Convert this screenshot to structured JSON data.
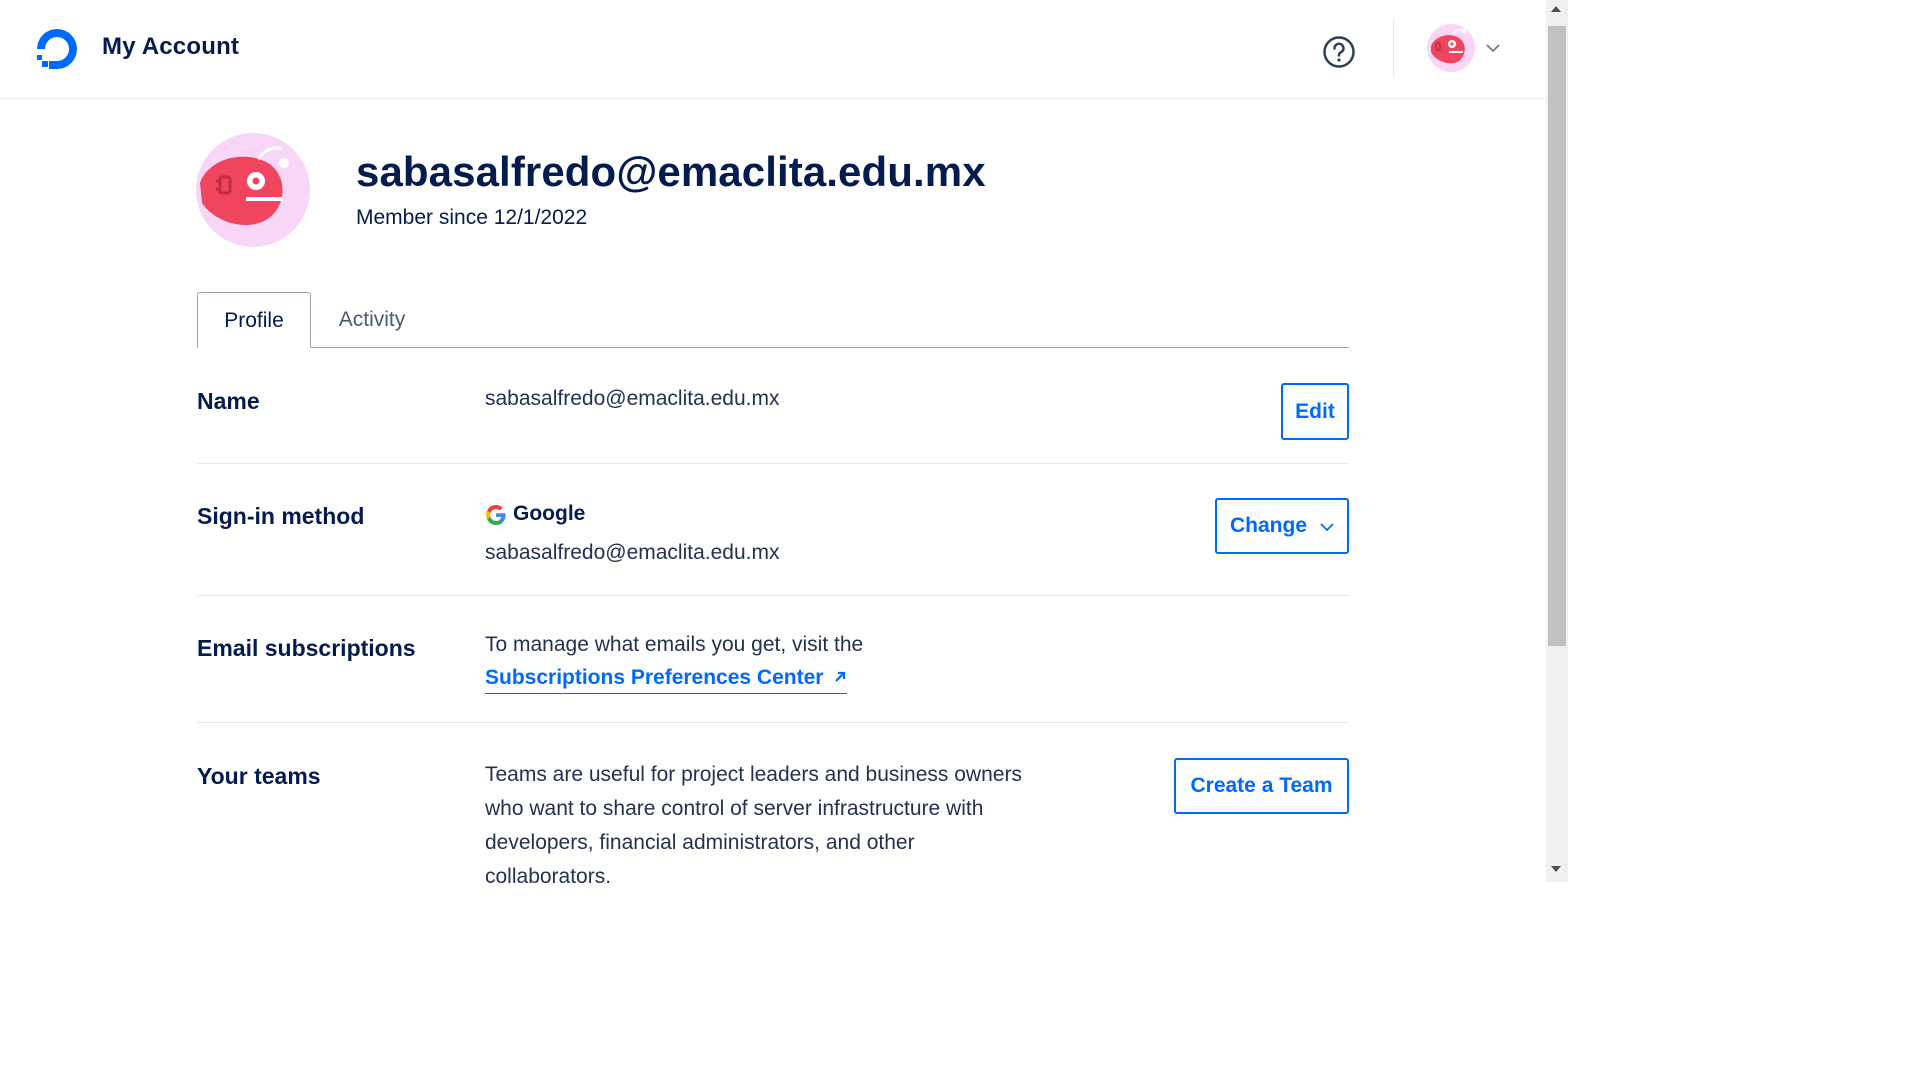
{
  "header": {
    "logo_icon": "digitalocean-logo-icon",
    "title": "My Account",
    "help_icon": "help-circle-icon",
    "avatar_icon": "anglerfish-avatar-icon",
    "menu_icon": "chevron-down-icon"
  },
  "profile": {
    "email": "sabasalfredo@emaclita.edu.mx",
    "member_since": "Member since 12/1/2022"
  },
  "tabs": [
    {
      "label": "Profile",
      "active": true
    },
    {
      "label": "Activity",
      "active": false
    }
  ],
  "rows": {
    "name": {
      "label": "Name",
      "value": "sabasalfredo@emaclita.edu.mx",
      "button": "Edit"
    },
    "signin": {
      "label": "Sign-in method",
      "provider": "Google",
      "provider_icon": "google-icon",
      "email": "sabasalfredo@emaclita.edu.mx",
      "button": "Change"
    },
    "email_subscriptions": {
      "label": "Email subscriptions",
      "text": "To manage what emails you get, visit the",
      "link": "Subscriptions Preferences Center",
      "link_icon": "external-arrow-icon"
    },
    "teams": {
      "label": "Your teams",
      "text": "Teams are useful for project leaders and business owners who want to share control of server infrastructure with developers, financial administrators, and other collaborators.",
      "button": "Create a Team"
    }
  },
  "colors": {
    "brand": "#0069ff",
    "text_dark": "#031b4e",
    "avatar_bg": "#f7d6f7",
    "avatar_fish": "#f0455f"
  }
}
